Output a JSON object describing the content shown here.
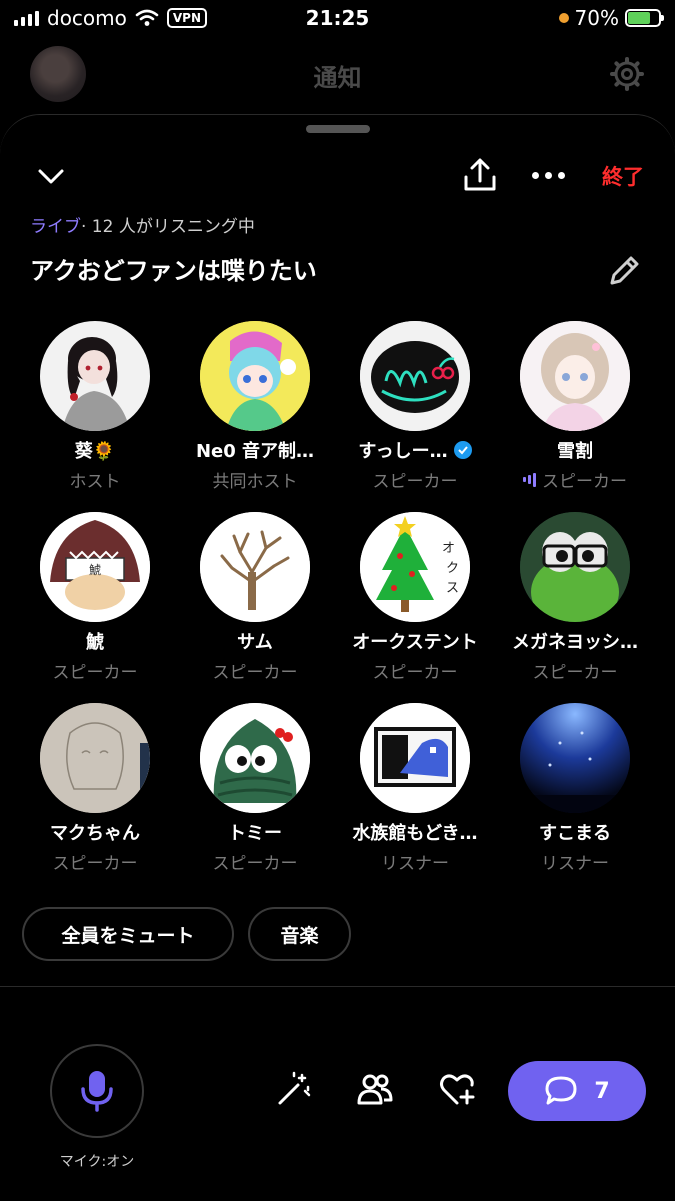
{
  "status_bar": {
    "carrier": "docomo",
    "vpn": "VPN",
    "time": "21:25",
    "battery": "70%"
  },
  "background_page": {
    "title": "通知"
  },
  "space": {
    "end_label": "終了",
    "live_label": "ライブ",
    "listening": "· 12 人がリスニング中",
    "title": "アクおどファンは喋りたい"
  },
  "participants": [
    {
      "name": "葵🌻",
      "role": "ホスト"
    },
    {
      "name": "Ne0 音ア制…",
      "role": "共同ホスト"
    },
    {
      "name": "すっしー…",
      "role": "スピーカー",
      "verified": true
    },
    {
      "name": "雪割",
      "role": "スピーカー",
      "speaking": true
    },
    {
      "name": "鯱",
      "role": "スピーカー"
    },
    {
      "name": "サム",
      "role": "スピーカー"
    },
    {
      "name": "オークステント",
      "role": "スピーカー"
    },
    {
      "name": "メガネヨッシ…",
      "role": "スピーカー"
    },
    {
      "name": "マクちゃん",
      "role": "スピーカー"
    },
    {
      "name": "トミー",
      "role": "スピーカー"
    },
    {
      "name": "水族館もどき…",
      "role": "リスナー"
    },
    {
      "name": "すこまる",
      "role": "リスナー"
    }
  ],
  "actions": {
    "mute_all": "全員をミュート",
    "music": "音楽"
  },
  "bottom": {
    "mic_label": "マイク:オン",
    "comment_count": "7"
  },
  "colors": {
    "accent": "#7062f0",
    "live": "#8f7cff",
    "end": "#ff2d2d",
    "verified": "#1d9bf0"
  }
}
